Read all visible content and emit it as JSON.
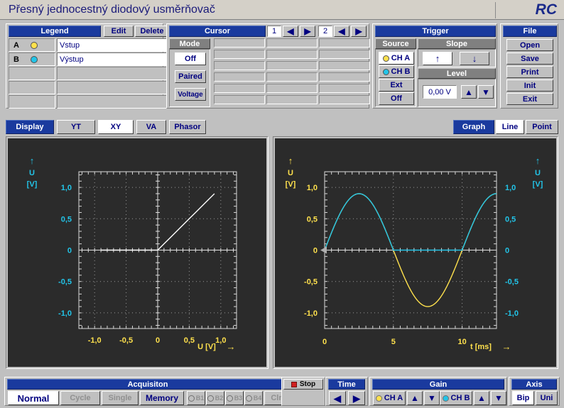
{
  "window": {
    "title": "Přesný jednocestný diodový usměrňovač",
    "logo": "RC"
  },
  "legend": {
    "header": "Legend",
    "edit_label": "Edit",
    "delete_label": "Delete",
    "rows": [
      {
        "key": "A",
        "color": "#ffe14d",
        "name": "Vstup"
      },
      {
        "key": "B",
        "color": "#22c4e8",
        "name": "Výstup"
      },
      {
        "key": "",
        "color": "",
        "name": ""
      },
      {
        "key": "",
        "color": "",
        "name": ""
      },
      {
        "key": "",
        "color": "",
        "name": ""
      }
    ]
  },
  "cursor": {
    "header": "Cursor",
    "cursor1_label": "1",
    "cursor2_label": "2",
    "prev_icon": "left-arrow-icon",
    "next_icon": "right-arrow-icon",
    "mode_header": "Mode",
    "modes": [
      {
        "label": "Off",
        "selected": true
      },
      {
        "label": "Paired",
        "selected": false
      },
      {
        "label": "Voltage",
        "selected": false
      }
    ],
    "grid_columns": 3,
    "grid_rows": 6,
    "grid_values": [
      [
        "",
        "",
        ""
      ],
      [
        "",
        "",
        ""
      ],
      [
        "",
        "",
        ""
      ],
      [
        "",
        "",
        ""
      ],
      [
        "",
        "",
        ""
      ],
      [
        "",
        "",
        ""
      ]
    ]
  },
  "trigger": {
    "header": "Trigger",
    "source_header": "Source",
    "sources": [
      {
        "label": "CH A",
        "color": "#ffe14d",
        "selected": true
      },
      {
        "label": "CH B",
        "color": "#22c4e8",
        "selected": false
      },
      {
        "label": "Ext",
        "color": "",
        "selected": false
      },
      {
        "label": "Off",
        "color": "",
        "selected": false
      }
    ],
    "slope_header": "Slope",
    "slope_rising": "↑",
    "slope_falling": "↓",
    "slope_selected": "rising",
    "level_header": "Level",
    "level_value": "0,00 V",
    "level_up_icon": "up-arrow-icon",
    "level_down_icon": "down-arrow-icon"
  },
  "file": {
    "header": "File",
    "buttons": [
      "Open",
      "Save",
      "Print",
      "Init",
      "Exit"
    ]
  },
  "display_tabs": {
    "header": "Display",
    "tabs": [
      {
        "label": "YT",
        "selected": false
      },
      {
        "label": "XY",
        "selected": true
      },
      {
        "label": "VA",
        "selected": false
      },
      {
        "label": "Phasor",
        "selected": false
      }
    ]
  },
  "graph_tabs": {
    "header": "Graph",
    "tabs": [
      {
        "label": "Line",
        "selected": true
      },
      {
        "label": "Point",
        "selected": false
      }
    ]
  },
  "chart_data": [
    {
      "type": "line",
      "name": "xy-plot",
      "title": "",
      "xlabel": "U [V]",
      "ylabel": "U",
      "yunit": "[V]",
      "xlim": [
        -1.25,
        1.25
      ],
      "ylim": [
        -1.25,
        1.25
      ],
      "xticks": [
        -1.0,
        -0.5,
        0,
        0.5,
        1.0
      ],
      "xticklabels": [
        "-1,0",
        "-0,5",
        "0",
        "0,5",
        "1,0"
      ],
      "yticks": [
        -1.0,
        -0.5,
        0,
        0.5,
        1.0
      ],
      "yticklabels": [
        "-1,0",
        "-0,5",
        "0",
        "0,5",
        "1,0"
      ],
      "xtick_color": "#ffe14d",
      "ytick_color": "#22c4e8",
      "grid": true,
      "legend": "none",
      "series": [
        {
          "name": "transfer-characteristic",
          "color": "#ffffff",
          "x": [
            -0.9,
            -0.75,
            -0.6,
            -0.45,
            -0.3,
            -0.15,
            -0.05,
            0.0,
            0.1,
            0.2,
            0.3,
            0.4,
            0.5,
            0.6,
            0.7,
            0.8,
            0.9
          ],
          "y": [
            0.0,
            0.0,
            0.0,
            0.0,
            0.0,
            0.0,
            0.0,
            0.0,
            0.1,
            0.2,
            0.3,
            0.4,
            0.5,
            0.6,
            0.7,
            0.8,
            0.9
          ]
        }
      ]
    },
    {
      "type": "line",
      "name": "yt-plot",
      "title": "",
      "xlabel": "t [ms]",
      "ylabel": "U",
      "yunit": "[V]",
      "xlim": [
        0,
        12.5
      ],
      "ylim": [
        -1.25,
        1.25
      ],
      "xticks": [
        0,
        5,
        10
      ],
      "xticklabels": [
        "0",
        "5",
        "10"
      ],
      "yticks": [
        -1.0,
        -0.5,
        0,
        0.5,
        1.0
      ],
      "yticklabels": [
        "-1,0",
        "-0,5",
        "0",
        "0,5",
        "1,0"
      ],
      "left_tick_color": "#ffe14d",
      "right_tick_color": "#22c4e8",
      "grid": true,
      "legend": "none",
      "series": [
        {
          "name": "Vstup",
          "color": "#ffe14d",
          "amplitude": 0.9,
          "period_ms": 10,
          "phase": 0,
          "waveform": "sine"
        },
        {
          "name": "Výstup",
          "color": "#22c4e8",
          "amplitude": 0.9,
          "period_ms": 10,
          "phase": 0,
          "waveform": "half-wave-rectified-sine"
        }
      ]
    }
  ],
  "acquisition": {
    "header": "Acquisiton",
    "modes": [
      {
        "label": "Normal",
        "selected": true,
        "disabled": false
      },
      {
        "label": "Cycle",
        "selected": false,
        "disabled": true
      },
      {
        "label": "Single",
        "selected": false,
        "disabled": true
      }
    ],
    "memory_label": "Memory",
    "buffers": [
      {
        "label": "B1",
        "disabled": true
      },
      {
        "label": "B2",
        "disabled": true
      },
      {
        "label": "B3",
        "disabled": true
      },
      {
        "label": "B4",
        "disabled": true
      }
    ],
    "clear_label": "Clr",
    "stop_label": "Stop",
    "stop_icon": "stop-square-icon",
    "stop_color": "#d02020"
  },
  "time": {
    "header": "Time",
    "prev_icon": "left-arrow-icon",
    "next_icon": "right-arrow-icon"
  },
  "gain": {
    "header": "Gain",
    "channels": [
      {
        "label": "CH A",
        "color": "#ffe14d"
      },
      {
        "label": "CH B",
        "color": "#22c4e8"
      }
    ],
    "up_icon": "up-arrow-icon",
    "down_icon": "down-arrow-icon"
  },
  "axis": {
    "header": "Axis",
    "options": [
      {
        "label": "Bip",
        "selected": true
      },
      {
        "label": "Uni",
        "selected": false
      }
    ]
  }
}
